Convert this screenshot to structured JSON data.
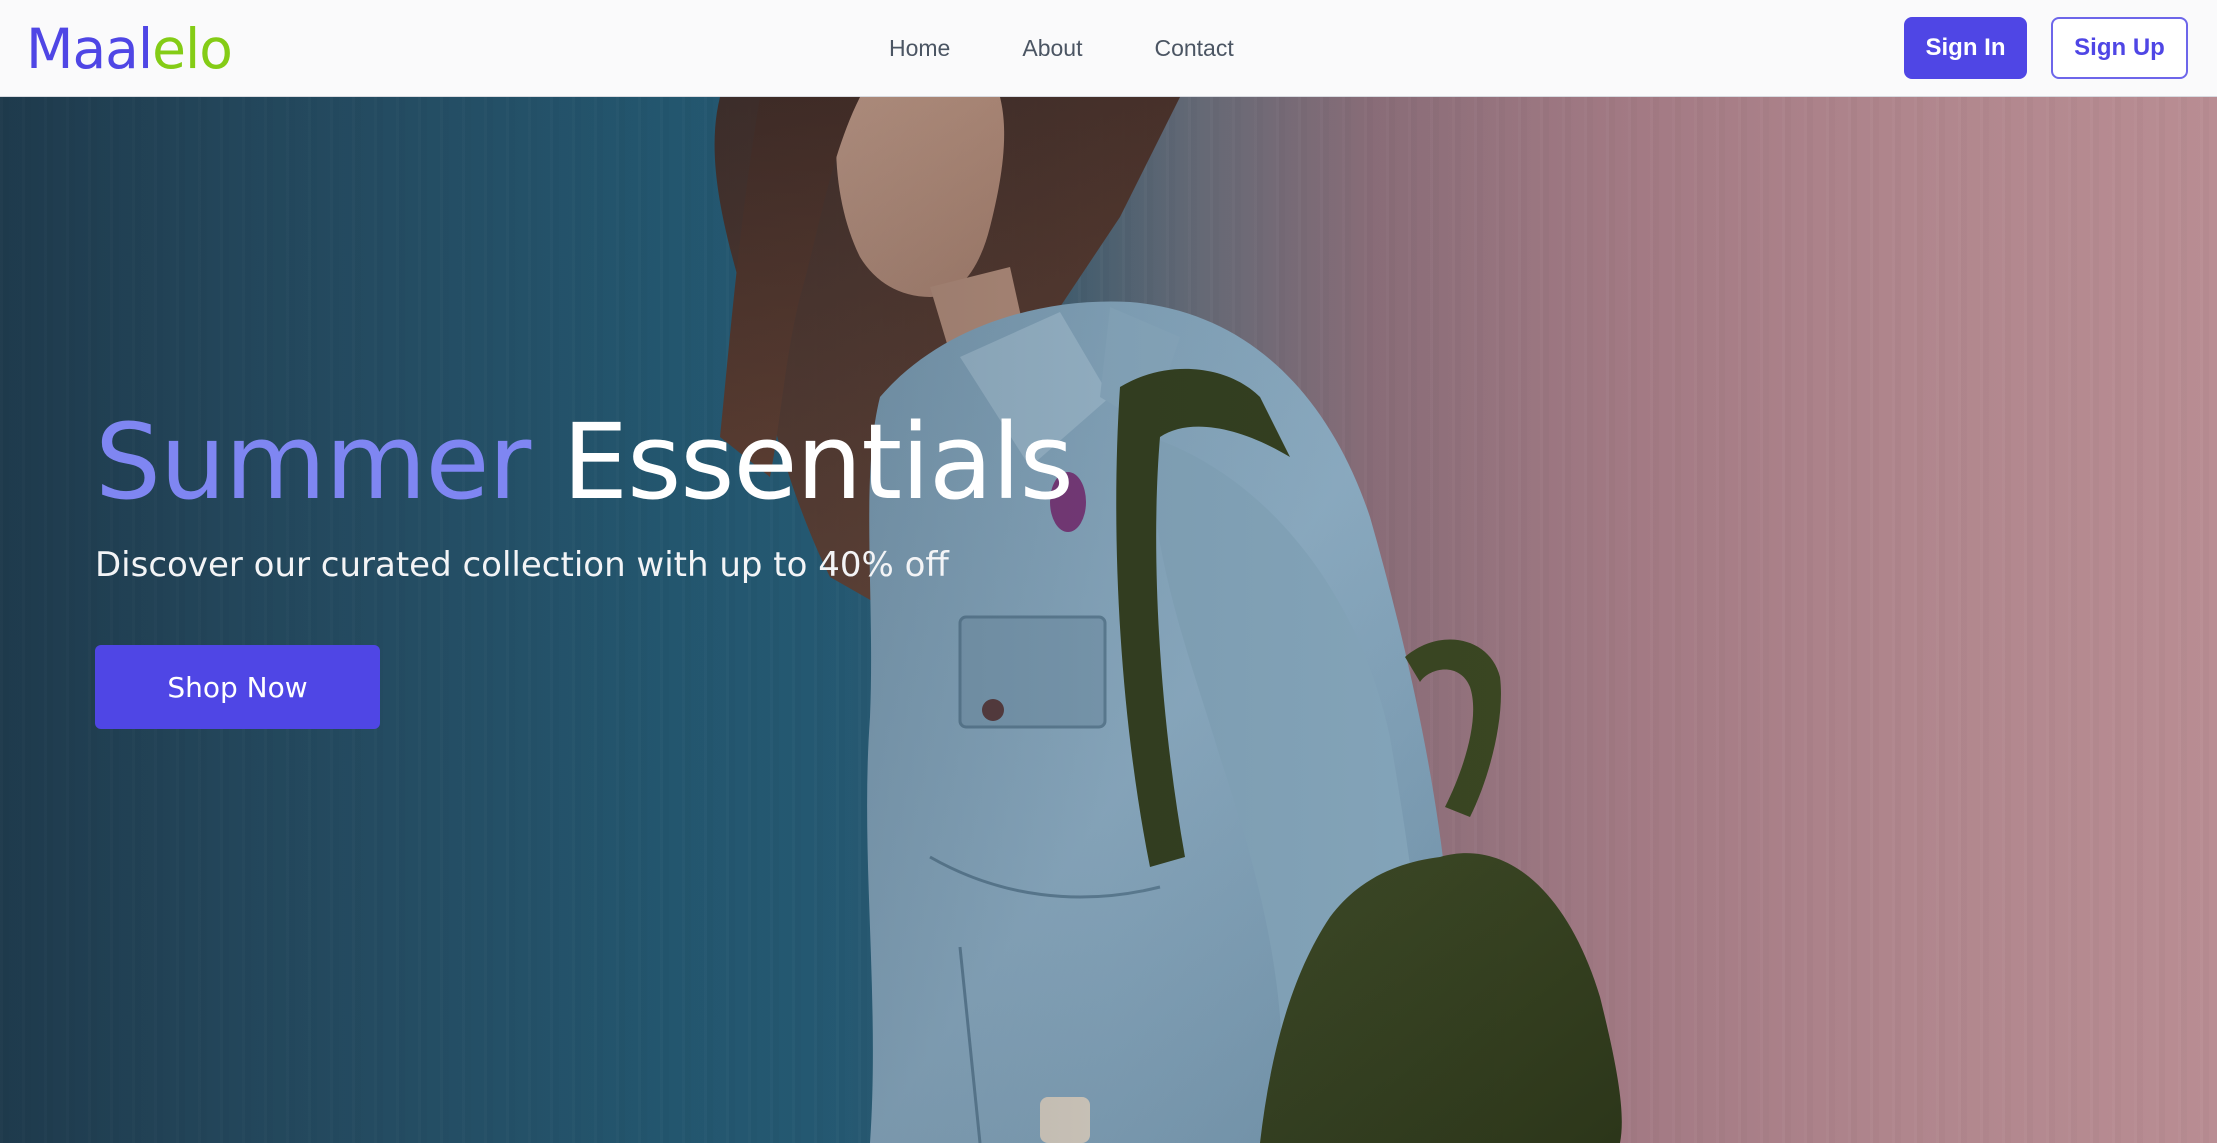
{
  "brand": {
    "logo_part1": "Maal",
    "logo_part2": "elo",
    "primary_color": "#4f46e5",
    "secondary_color": "#84cc16"
  },
  "nav": {
    "links": [
      {
        "label": "Home"
      },
      {
        "label": "About"
      },
      {
        "label": "Contact"
      }
    ],
    "sign_in_label": "Sign In",
    "sign_up_label": "Sign Up"
  },
  "hero": {
    "title_accent": "Summer",
    "title_main": "Essentials",
    "subtitle": "Discover our curated collection with up to 40% off",
    "cta_label": "Shop Now",
    "accent_color": "#7f86f2",
    "background_image": "woman-in-denim-jacket-with-backpack"
  }
}
